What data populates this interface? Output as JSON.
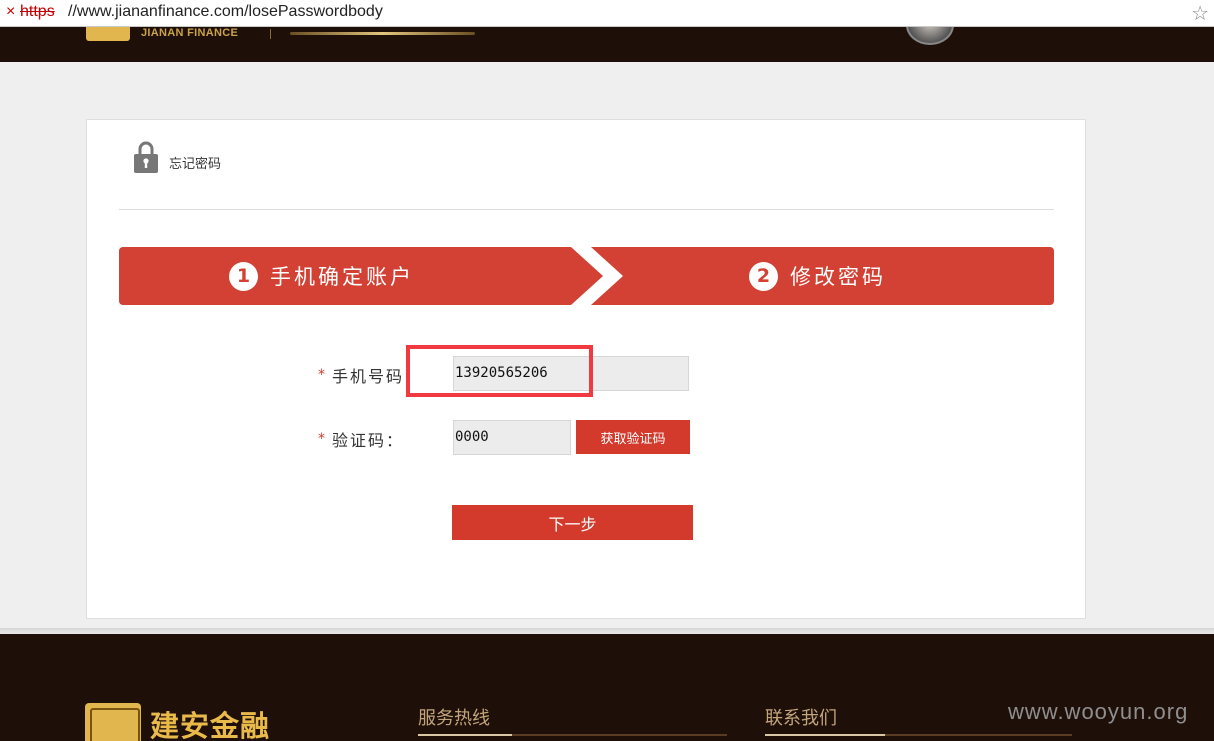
{
  "browser": {
    "url_scheme": "https",
    "url_rest": "//www.jiananfinance.com/losePasswordbody",
    "insecure_mark": "×"
  },
  "header": {
    "logo_text": "JIANAN FINANCE"
  },
  "card": {
    "title": "忘记密码",
    "steps": [
      {
        "number": "1",
        "label": "手机确定账户"
      },
      {
        "number": "2",
        "label": "修改密码"
      }
    ],
    "phone": {
      "required_mark": "*",
      "label": "手机号码：",
      "value": "13920565206"
    },
    "code": {
      "required_mark": "*",
      "label": "验证码：",
      "value": "0000",
      "send_button": "获取验证码"
    },
    "next_button": "下一步"
  },
  "footer": {
    "logo_text": "建安金融",
    "hotline_heading": "服务热线",
    "contact_heading": "联系我们"
  },
  "watermark": "www.wooyun.org",
  "colors": {
    "accent_red": "#d33a2c",
    "highlight_red": "#f03a3f",
    "header_dark": "#1e0f08",
    "gold": "#e2b64e"
  }
}
